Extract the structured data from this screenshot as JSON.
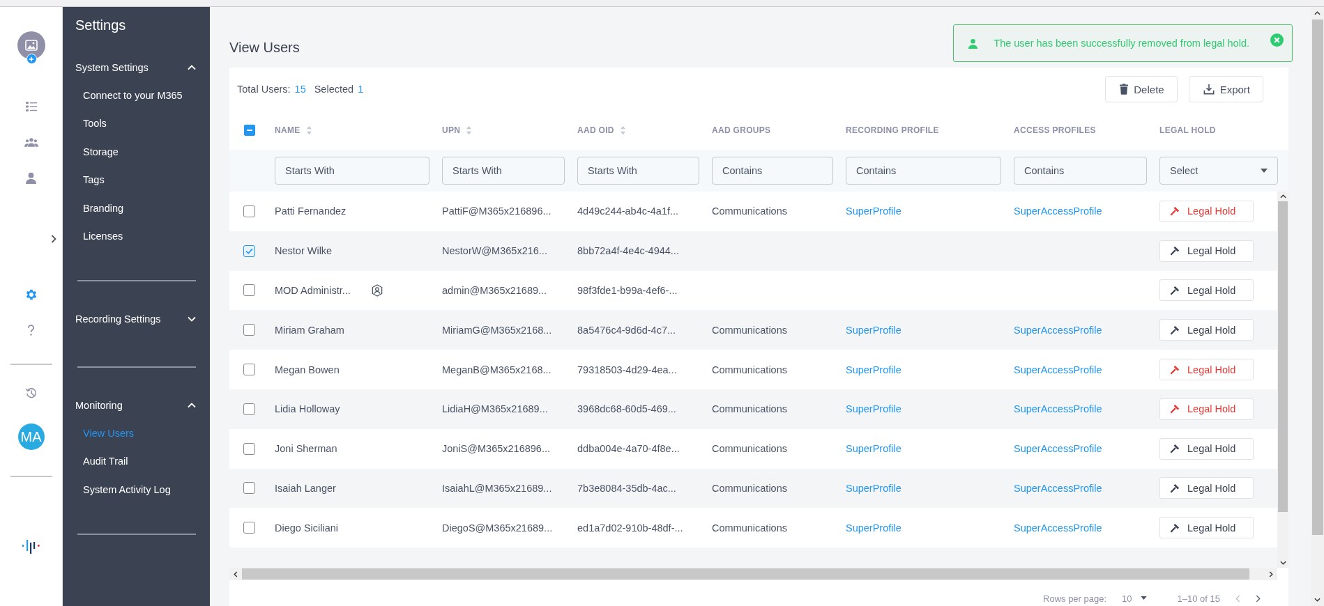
{
  "rail": {
    "items": [
      {
        "kind": "list",
        "selected": false
      },
      {
        "kind": "team",
        "selected": false
      },
      {
        "kind": "person",
        "selected": false
      },
      {
        "kind": "expand",
        "selected": false
      },
      {
        "kind": "settings",
        "selected": true
      },
      {
        "kind": "help",
        "selected": false
      },
      {
        "kind": "history",
        "selected": false
      }
    ],
    "user_initials": "MA"
  },
  "sidebar": {
    "title": "Settings",
    "sections": [
      {
        "label": "System Settings",
        "expanded": true,
        "items": [
          {
            "label": "Connect to your M365",
            "selected": false
          },
          {
            "label": "Tools",
            "selected": false
          },
          {
            "label": "Storage",
            "selected": false
          },
          {
            "label": "Tags",
            "selected": false
          },
          {
            "label": "Branding",
            "selected": false
          },
          {
            "label": "Licenses",
            "selected": false
          }
        ]
      },
      {
        "label": "Recording Settings",
        "expanded": false
      },
      {
        "label": "Monitoring",
        "expanded": true,
        "items": [
          {
            "label": "View Users",
            "selected": true
          },
          {
            "label": "Audit Trail",
            "selected": false
          },
          {
            "label": "System Activity Log",
            "selected": false
          }
        ]
      }
    ]
  },
  "page_title": "View Users",
  "toast": {
    "message": "The user has been successfully removed from legal hold."
  },
  "summary": {
    "total_label": "Total Users:",
    "total": "15",
    "selected_label": "Selected",
    "selected": "1"
  },
  "actions": [
    {
      "kind": "delete",
      "label": "Delete"
    },
    {
      "kind": "export",
      "label": "Export"
    }
  ],
  "table": {
    "header_checkbox": {
      "indeterminate": true
    },
    "columns": [
      {
        "label": "NAME",
        "sortable": true,
        "filter": {
          "kind": "text",
          "placeholder": "Starts With"
        }
      },
      {
        "label": "UPN",
        "sortable": true,
        "filter": {
          "kind": "text",
          "placeholder": "Starts With"
        }
      },
      {
        "label": "AAD OID",
        "sortable": true,
        "filter": {
          "kind": "text",
          "placeholder": "Starts With"
        }
      },
      {
        "label": "AAD GROUPS",
        "sortable": false,
        "filter": {
          "kind": "text",
          "placeholder": "Contains"
        }
      },
      {
        "label": "RECORDING PROFILE",
        "sortable": false,
        "filter": {
          "kind": "text",
          "placeholder": "Contains"
        }
      },
      {
        "label": "ACCESS PROFILES",
        "sortable": false,
        "filter": {
          "kind": "text",
          "placeholder": "Contains"
        }
      },
      {
        "label": "LEGAL HOLD",
        "sortable": false,
        "filter": {
          "kind": "select",
          "value": "Select"
        }
      }
    ],
    "rows": [
      {
        "checked": false,
        "name": "Patti Fernandez",
        "admin": false,
        "upn": "PattiF@M365x216896...",
        "oid": "4d49c244-ab4c-4a1f...",
        "groups": "Communications",
        "recording_profile": "SuperProfile",
        "access_profile": "SuperAccessProfile",
        "legal_hold": {
          "label": "Legal Hold",
          "on": true
        }
      },
      {
        "checked": true,
        "name": "Nestor Wilke",
        "admin": false,
        "upn": "NestorW@M365x216...",
        "oid": "8bb72a4f-4e4c-4944...",
        "legal_hold": {
          "label": "Legal Hold",
          "on": false
        }
      },
      {
        "checked": false,
        "name": "MOD Administr...",
        "admin": true,
        "upn": "admin@M365x21689...",
        "oid": "98f3fde1-b99a-4ef6-...",
        "legal_hold": {
          "label": "Legal Hold",
          "on": false
        }
      },
      {
        "checked": false,
        "name": "Miriam Graham",
        "admin": false,
        "upn": "MiriamG@M365x2168...",
        "oid": "8a5476c4-9d6d-4c7...",
        "groups": "Communications",
        "recording_profile": "SuperProfile",
        "access_profile": "SuperAccessProfile",
        "legal_hold": {
          "label": "Legal Hold",
          "on": false
        }
      },
      {
        "checked": false,
        "name": "Megan Bowen",
        "admin": false,
        "upn": "MeganB@M365x2168...",
        "oid": "79318503-4d29-4ea...",
        "groups": "Communications",
        "recording_profile": "SuperProfile",
        "access_profile": "SuperAccessProfile",
        "legal_hold": {
          "label": "Legal Hold",
          "on": true
        }
      },
      {
        "checked": false,
        "name": "Lidia Holloway",
        "admin": false,
        "upn": "LidiaH@M365x21689...",
        "oid": "3968dc68-60d5-469...",
        "groups": "Communications",
        "recording_profile": "SuperProfile",
        "access_profile": "SuperAccessProfile",
        "legal_hold": {
          "label": "Legal Hold",
          "on": true
        }
      },
      {
        "checked": false,
        "name": "Joni Sherman",
        "admin": false,
        "upn": "JoniS@M365x216896...",
        "oid": "ddba004e-4a70-4f8e...",
        "groups": "Communications",
        "recording_profile": "SuperProfile",
        "access_profile": "SuperAccessProfile",
        "legal_hold": {
          "label": "Legal Hold",
          "on": false
        }
      },
      {
        "checked": false,
        "name": "Isaiah Langer",
        "admin": false,
        "upn": "IsaiahL@M365x21689...",
        "oid": "7b3e8084-35db-4ac...",
        "groups": "Communications",
        "recording_profile": "SuperProfile",
        "access_profile": "SuperAccessProfile",
        "legal_hold": {
          "label": "Legal Hold",
          "on": false
        }
      },
      {
        "checked": false,
        "name": "Diego Siciliani",
        "admin": false,
        "upn": "DiegoS@M365x21689...",
        "oid": "ed1a7d02-910b-48df-...",
        "groups": "Communications",
        "recording_profile": "SuperProfile",
        "access_profile": "SuperAccessProfile",
        "legal_hold": {
          "label": "Legal Hold",
          "on": false
        }
      }
    ]
  },
  "pagination": {
    "rows_per_page_label": "Rows per page:",
    "rows_per_page": "10",
    "range": "1–10 of 15"
  }
}
